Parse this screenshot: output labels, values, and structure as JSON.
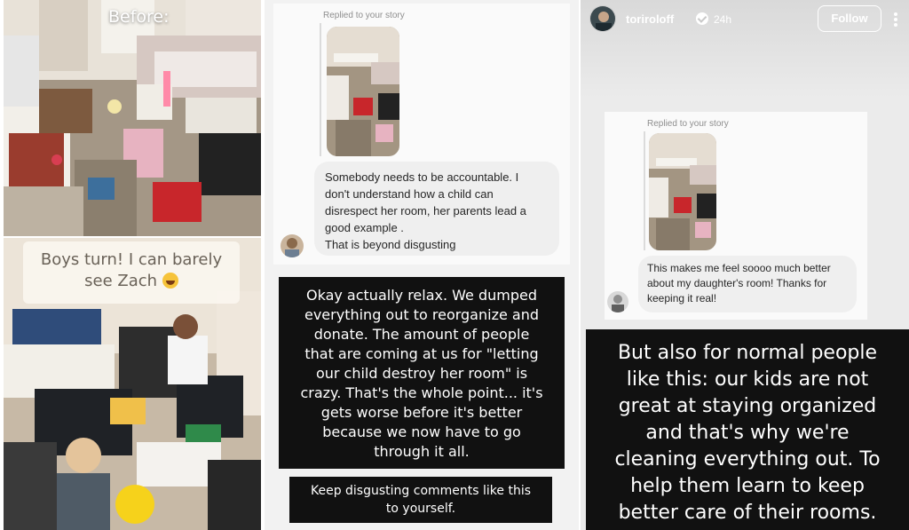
{
  "panel1": {
    "before_label": "Before:",
    "boys_caption_line1": "Boys turn! I can barely",
    "boys_caption_line2": "see Zach"
  },
  "panel2": {
    "replied_label": "Replied to your story",
    "comment_lines": [
      "Somebody needs to be accountable. I",
      "don't understand how a child can",
      "disrespect her room, her parents lead a",
      "good example .",
      "That is beyond disgusting"
    ],
    "response_lines": [
      "Okay actually relax. We dumped",
      "everything out to reorganize and",
      "donate. The amount of people",
      "that are coming at us for \"letting",
      "our child destroy her room\" is",
      "crazy. That's the whole point... it's",
      "gets worse before it's better",
      "because we now have to go",
      "through it all."
    ],
    "keep_lines": [
      "Keep disgusting comments like this",
      "to yourself."
    ]
  },
  "panel3": {
    "username": "toriroloff",
    "time": "24h",
    "follow_label": "Follow",
    "replied_label": "Replied to your story",
    "message_lines": [
      "This makes me feel soooo much better",
      "about my daughter's room! Thanks for",
      "keeping it real!"
    ],
    "statement_lines": [
      "But also for normal people",
      "like this: our kids are not",
      "great at staying organized",
      "and that's why we're",
      "cleaning everything out. To",
      "help them learn to keep",
      "better care of their rooms."
    ]
  },
  "icons": {
    "verified": "verified-badge-icon",
    "more": "more-options-icon",
    "emoji": "laughing-emoji-icon"
  }
}
